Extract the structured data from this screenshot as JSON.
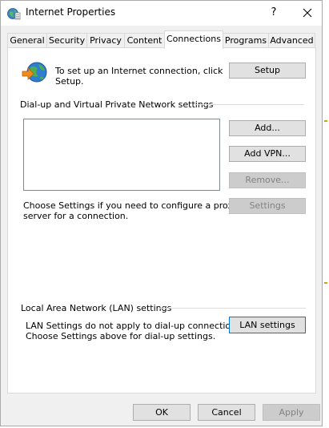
{
  "window": {
    "title": "Internet Properties",
    "help_label": "?",
    "icon": "internet-options-icon",
    "close_icon": "close-icon"
  },
  "tabs": [
    {
      "label": "General",
      "active": false
    },
    {
      "label": "Security",
      "active": false
    },
    {
      "label": "Privacy",
      "active": false
    },
    {
      "label": "Content",
      "active": false
    },
    {
      "label": "Connections",
      "active": true
    },
    {
      "label": "Programs",
      "active": false
    },
    {
      "label": "Advanced",
      "active": false
    }
  ],
  "connections": {
    "setup_icon": "globe-arrow-icon",
    "setup_text_line1": "To set up an Internet connection, click",
    "setup_text_line2": "Setup.",
    "setup_button": "Setup",
    "dialup_group_label": "Dial-up and Virtual Private Network settings",
    "add_button": "Add...",
    "add_vpn_button": "Add VPN...",
    "remove_button": "Remove...",
    "proxy_text_line1": "Choose Settings if you need to configure a proxy",
    "proxy_text_line2": "server for a connection.",
    "settings_button": "Settings",
    "lan_group_label": "Local Area Network (LAN) settings",
    "lan_text_line1": "LAN Settings do not apply to dial-up connections.",
    "lan_text_line2": "Choose Settings above for dial-up settings.",
    "lan_settings_button": "LAN settings"
  },
  "footer": {
    "ok_button": "OK",
    "cancel_button": "Cancel",
    "apply_button": "Apply"
  },
  "colors": {
    "accent": "#0078d7",
    "dialog_bg": "#f0f0f0",
    "button_bg": "#e1e1e1",
    "disabled_text": "#838383"
  }
}
